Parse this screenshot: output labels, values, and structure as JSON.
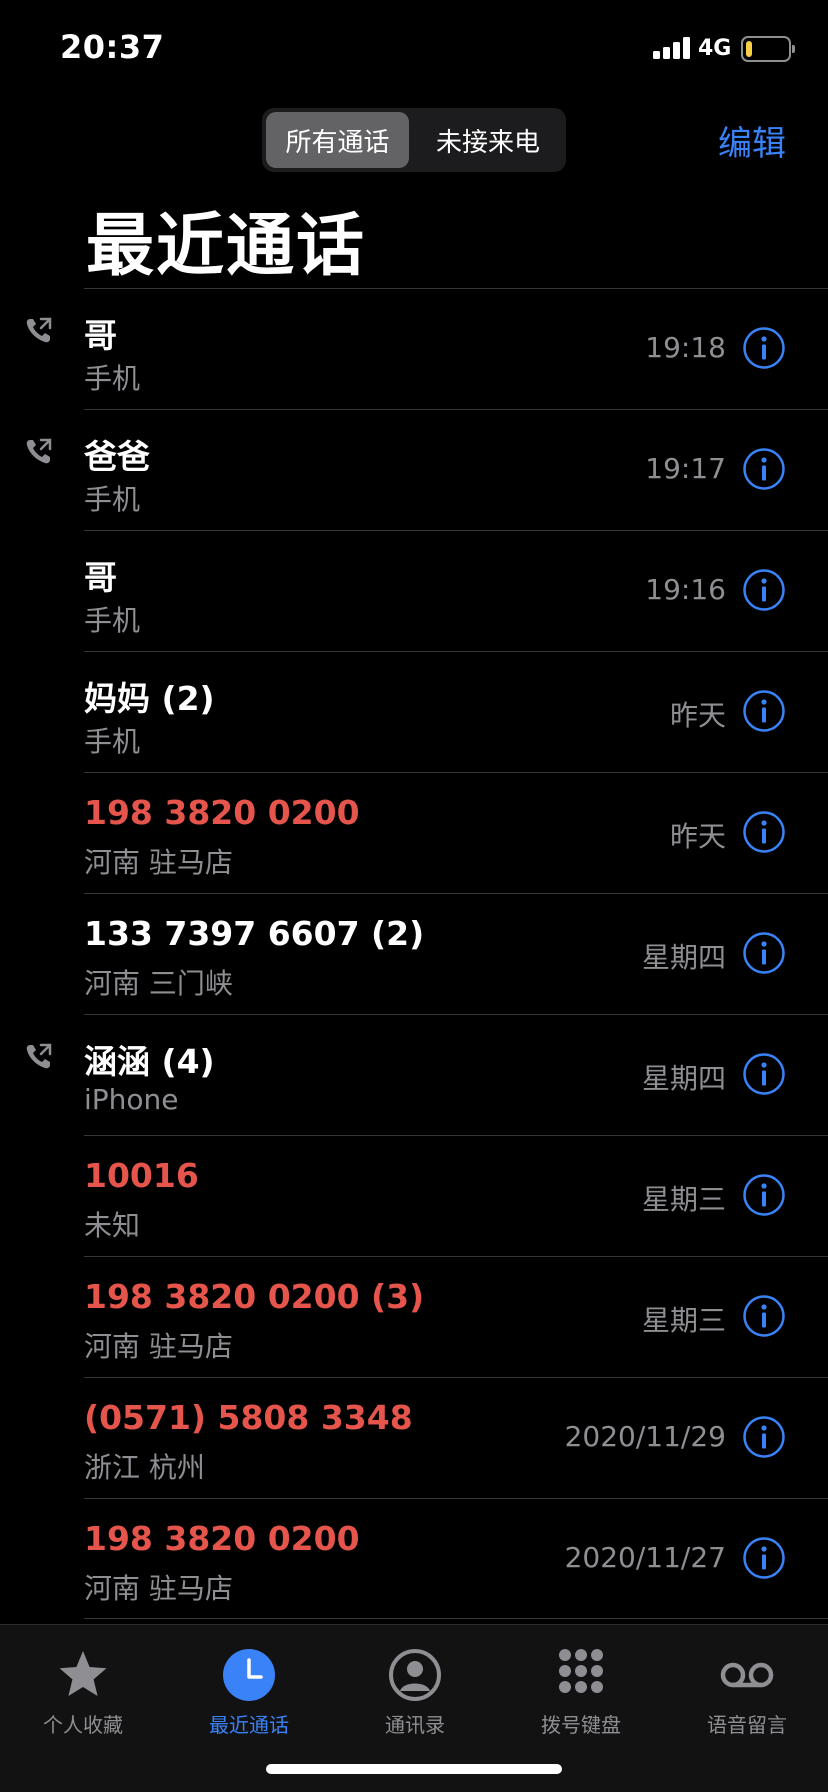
{
  "status": {
    "time": "20:37",
    "network": "4G",
    "battery_level": 0.15,
    "battery_color": "#f7ce46"
  },
  "segmented": {
    "all_calls": "所有通话",
    "missed": "未接来电"
  },
  "nav": {
    "edit_label": "编辑",
    "title": "最近通话"
  },
  "calls": [
    {
      "name": "哥",
      "label": "手机",
      "time": "19:18",
      "missed": false,
      "outgoing": true
    },
    {
      "name": "爸爸",
      "label": "手机",
      "time": "19:17",
      "missed": false,
      "outgoing": true
    },
    {
      "name": "哥",
      "label": "手机",
      "time": "19:16",
      "missed": false,
      "outgoing": false
    },
    {
      "name": "妈妈 (2)",
      "label": "手机",
      "time": "昨天",
      "missed": false,
      "outgoing": false
    },
    {
      "name": "198 3820 0200",
      "label": "河南 驻马店",
      "time": "昨天",
      "missed": true,
      "outgoing": false
    },
    {
      "name": "133 7397 6607 (2)",
      "label": "河南 三门峡",
      "time": "星期四",
      "missed": false,
      "outgoing": false
    },
    {
      "name": "涵涵 (4)",
      "label": "iPhone",
      "time": "星期四",
      "missed": false,
      "outgoing": true
    },
    {
      "name": "10016",
      "label": "未知",
      "time": "星期三",
      "missed": true,
      "outgoing": false
    },
    {
      "name": "198 3820 0200 (3)",
      "label": "河南 驻马店",
      "time": "星期三",
      "missed": true,
      "outgoing": false
    },
    {
      "name": "(0571) 5808 3348",
      "label": "浙江 杭州",
      "time": "2020/11/29",
      "missed": true,
      "outgoing": false
    },
    {
      "name": "198 3820 0200",
      "label": "河南 驻马店",
      "time": "2020/11/27",
      "missed": true,
      "outgoing": false
    }
  ],
  "tabs": [
    {
      "label": "个人收藏",
      "icon": "star-icon",
      "active": false
    },
    {
      "label": "最近通话",
      "icon": "clock-icon",
      "active": true
    },
    {
      "label": "通讯录",
      "icon": "person-circle-icon",
      "active": false
    },
    {
      "label": "拨号键盘",
      "icon": "keypad-icon",
      "active": false
    },
    {
      "label": "语音留言",
      "icon": "voicemail-icon",
      "active": false
    }
  ],
  "colors": {
    "accent": "#3a82f7",
    "missed": "#e5554b",
    "secondary": "#8e8e93"
  }
}
